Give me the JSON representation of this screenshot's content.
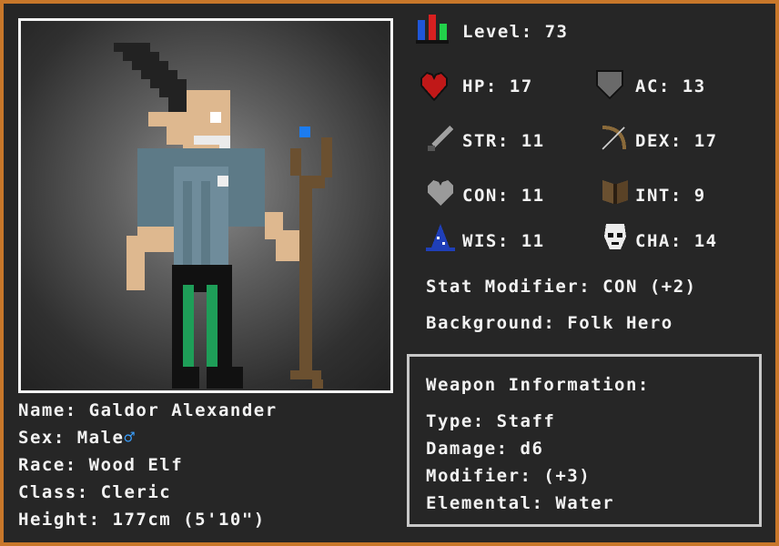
{
  "character": {
    "name_line": "Name: Galdor Alexander",
    "sex_line": "Sex: Male",
    "sex_symbol": "♂",
    "race_line": "Race: Wood Elf",
    "class_line": "Class: Cleric",
    "height_line": "Height: 177cm (5'10\")"
  },
  "stats": {
    "level": "Level: 73",
    "hp": "HP: 17",
    "ac": "AC: 13",
    "str": "STR: 11",
    "dex": "DEX: 17",
    "con": "CON: 11",
    "int": "INT: 9",
    "wis": "WIS: 11",
    "cha": "CHA: 14",
    "modifier": "Stat Modifier: CON (+2)",
    "background": "Background: Folk Hero"
  },
  "weapon": {
    "heading": "Weapon Information:",
    "type": "Type: Staff",
    "damage": "Damage: d6",
    "modifier": "Modifier: (+3)",
    "elemental": "Elemental: Water"
  },
  "icons": {
    "level": "level-bars-icon",
    "hp": "heart-icon",
    "ac": "shield-icon",
    "str": "sword-icon",
    "dex": "bow-icon",
    "con": "grey-heart-icon",
    "int": "book-icon",
    "wis": "wizard-hat-icon",
    "cha": "mask-icon"
  },
  "colors": {
    "frame": "#c8772a",
    "panel": "#262626",
    "text": "#f2f2f2",
    "male_symbol": "#3aa0ff"
  }
}
